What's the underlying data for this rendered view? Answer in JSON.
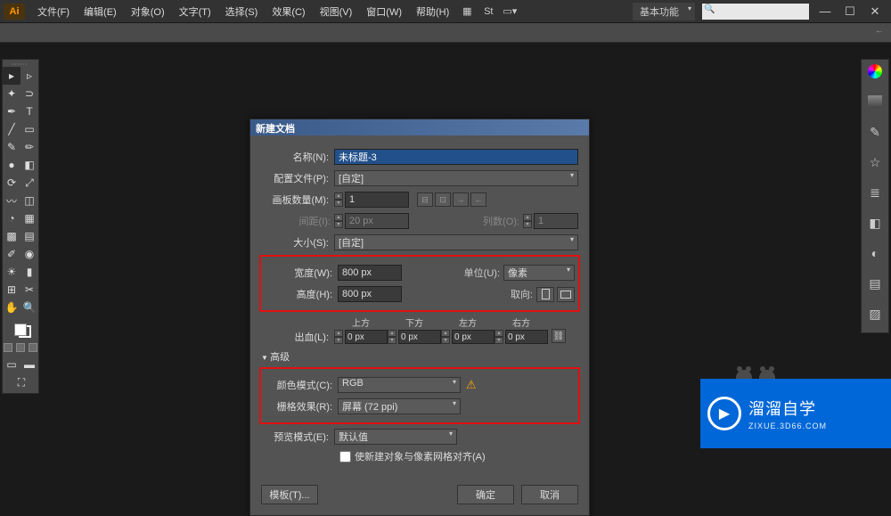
{
  "menubar": {
    "app_badge": "Ai",
    "items": [
      "文件(F)",
      "编辑(E)",
      "对象(O)",
      "文字(T)",
      "选择(S)",
      "效果(C)",
      "视图(V)",
      "窗口(W)",
      "帮助(H)"
    ],
    "workspace": "基本功能"
  },
  "dialog": {
    "title": "新建文档",
    "fields": {
      "name_label": "名称(N):",
      "name_value": "未标题-3",
      "profile_label": "配置文件(P):",
      "profile_value": "[自定]",
      "artboards_label": "画板数量(M):",
      "artboards_value": "1",
      "spacing_label": "间距(I):",
      "spacing_value": "20 px",
      "columns_label": "列数(O):",
      "columns_value": "1",
      "size_label": "大小(S):",
      "size_value": "[自定]",
      "width_label": "宽度(W):",
      "width_value": "800 px",
      "units_label": "单位(U):",
      "units_value": "像素",
      "height_label": "高度(H):",
      "height_value": "800 px",
      "orient_label": "取向:",
      "bleed_label": "出血(L):",
      "bleed_top": "上方",
      "bleed_bottom": "下方",
      "bleed_left": "左方",
      "bleed_right": "右方",
      "bleed_val": "0 px",
      "advanced_label": "高级",
      "colormode_label": "颜色模式(C):",
      "colormode_value": "RGB",
      "raster_label": "栅格效果(R):",
      "raster_value": "屏幕 (72 ppi)",
      "preview_label": "预览模式(E):",
      "preview_value": "默认值",
      "align_checkbox": "使新建对象与像素网格对齐(A)"
    },
    "buttons": {
      "template": "模板(T)...",
      "ok": "确定",
      "cancel": "取消"
    }
  },
  "watermark": {
    "title": "溜溜自学",
    "sub": "ZIXUE.3D66.COM"
  }
}
